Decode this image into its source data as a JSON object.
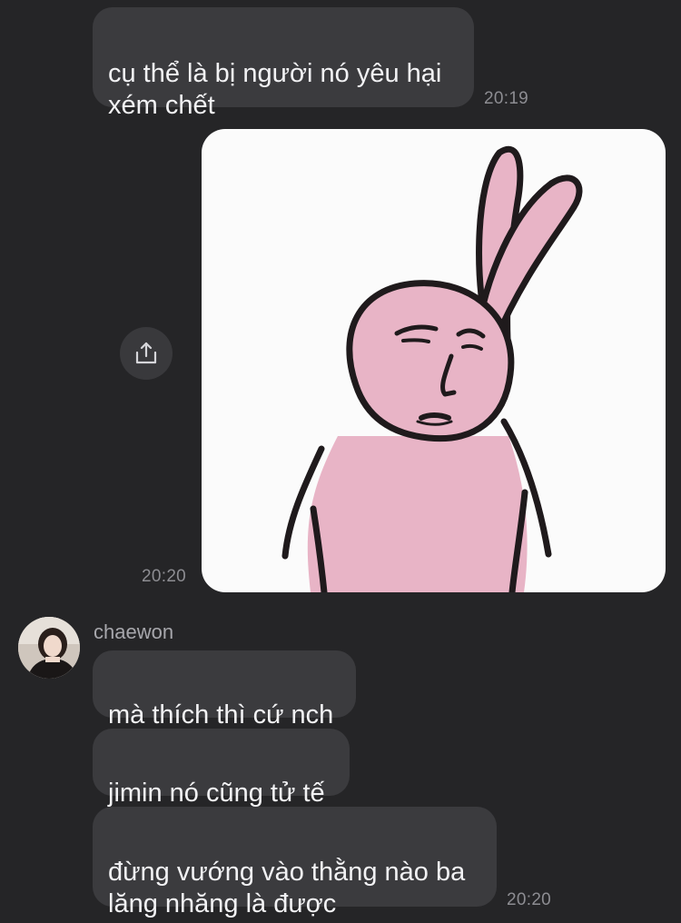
{
  "messages": {
    "m1": {
      "text": "cụ thể là bị người nó yêu hại\nxém chết",
      "time": "20:19"
    },
    "sticker": {
      "time": "20:20"
    },
    "m3": {
      "text": "mà thích thì cứ nch"
    },
    "m4": {
      "text": "jimin nó cũng tử tế"
    },
    "m5": {
      "text": "đừng vướng vào thằng nào ba\nlăng nhăng là được",
      "time": "20:20"
    }
  },
  "contact": {
    "name": "chaewon"
  },
  "icons": {
    "share": "share-upload-icon",
    "sticker": "pink-rabbit-sticker",
    "avatar": "profile-photo"
  },
  "colors": {
    "background": "#252527",
    "bubble": "#3b3b3e",
    "text": "#f2f2f4",
    "timestamp": "#8d8d92",
    "rabbit_pink": "#e8b4c6"
  }
}
